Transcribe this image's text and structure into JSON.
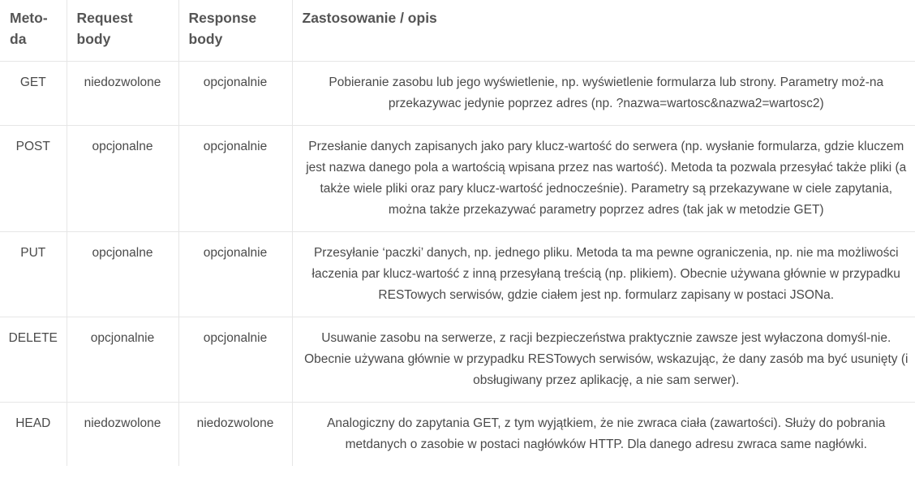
{
  "table": {
    "headers": [
      "Meto-\nda",
      "Request\nbody",
      "Response\nbody",
      "Zastosowanie / opis"
    ],
    "rows": [
      {
        "method": "GET",
        "request": "niedozwolone",
        "response": "opcjonalnie",
        "description": "Pobieranie zasobu lub jego wyświetlenie, np. wyświetlenie formularza lub strony. Parametry moż-na przekazywac jedynie poprzez adres (np. ?nazwa=wartosc&nazwa2=wartosc2)"
      },
      {
        "method": "POST",
        "request": "opcjonalne",
        "response": "opcjonalnie",
        "description": "Przesłanie danych zapisanych jako pary klucz-wartość do serwera (np. wysłanie formularza, gdzie kluczem jest nazwa danego pola a wartością wpisana przez nas wartość). Metoda ta pozwala przesyłać także pliki (a także wiele pliki oraz pary klucz-wartość jednocześnie). Parametry są przekazywane w ciele zapytania, można także przekazywać parametry poprzez adres (tak jak w metodzie GET)"
      },
      {
        "method": "PUT",
        "request": "opcjonalne",
        "response": "opcjonalnie",
        "description": "Przesyłanie ‘paczki’ danych, np. jednego pliku. Metoda ta ma pewne ograniczenia, np. nie ma możliwości łaczenia par klucz-wartość z inną przesyłaną treścią (np. plikiem). Obecnie używana głównie w przypadku RESTowych serwisów, gdzie ciałem jest np. formularz zapisany w postaci JSONa."
      },
      {
        "method": "DELETE",
        "request": "opcjonalnie",
        "response": "opcjonalnie",
        "description": "Usuwanie zasobu na serwerze, z racji bezpieczeństwa praktycznie zawsze jest wyłaczona domyśl-nie. Obecnie używana głównie w przypadku RESTowych serwisów, wskazując, że dany zasób ma być usunięty (i obsługiwany przez aplikację, a nie sam serwer)."
      },
      {
        "method": "HEAD",
        "request": "niedozwolone",
        "response": "niedozwolone",
        "description": "Analogiczny do zapytania GET, z tym wyjątkiem, że nie zwraca ciała (zawartości). Służy do pobrania metdanych o zasobie w postaci nagłówków HTTP. Dla danego adresu zwraca same nagłówki."
      }
    ]
  }
}
